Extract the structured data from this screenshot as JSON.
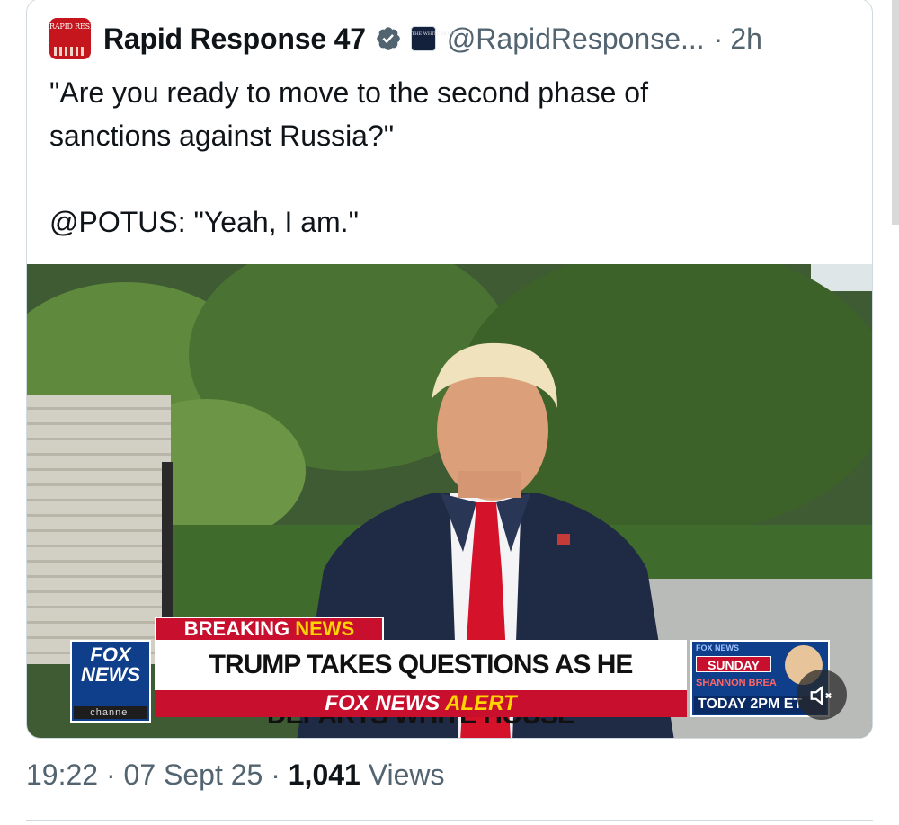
{
  "quote": {
    "avatar_text": "RAPID RESPONSE",
    "display_name": "Rapid Response 47",
    "affiliate_badge_text": "THE WHITE HOUSE",
    "handle": "@RapidResponse...",
    "separator": "·",
    "time": "2h",
    "text": "\"Are you ready to move to the second phase of\nsanctions against Russia?\"\n\n@POTUS: \"Yeah, I am.\""
  },
  "video": {
    "breaking_label": "BREAKING",
    "breaking_news_word": "NEWS",
    "network_logo_line1": "FOX",
    "network_logo_line2": "NEWS",
    "network_logo_line3": "channel",
    "headline": "TRUMP TAKES QUESTIONS AS HE DEPARTS WHITE HOUSE",
    "alert_brand": "FOX NEWS",
    "alert_word": "ALERT",
    "promo_top": "FOX NEWS",
    "promo_show": "SUNDAY",
    "promo_host": "SHANNON BREA",
    "promo_time": "TODAY 2PM ET",
    "mute_icon": "speaker-muted-icon"
  },
  "meta": {
    "time": "19:22",
    "sep1": "·",
    "date": "07 Sept 25",
    "sep2": "·",
    "views_count": "1,041",
    "views_label": "Views"
  },
  "colors": {
    "verified": "#536471",
    "fox_red": "#c8102e",
    "fox_blue": "#0f3e8a",
    "secondary_text": "#536471"
  }
}
